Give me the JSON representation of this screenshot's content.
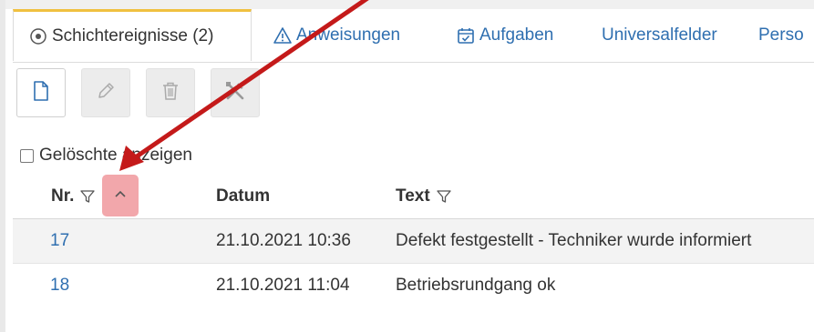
{
  "tabs": [
    {
      "label": "Schichtereignisse (2)",
      "icon": "target-icon",
      "active": true
    },
    {
      "label": "Anweisungen",
      "icon": "warning-icon",
      "active": false
    },
    {
      "label": "Aufgaben",
      "icon": "calendar-check-icon",
      "active": false
    },
    {
      "label": "Universalfelder",
      "icon": "",
      "active": false
    },
    {
      "label": "Perso",
      "icon": "",
      "active": false
    }
  ],
  "toolbar": [
    {
      "name": "new-document",
      "icon": "document-icon",
      "enabled": true
    },
    {
      "name": "edit",
      "icon": "pencil-icon",
      "enabled": false
    },
    {
      "name": "delete",
      "icon": "trash-icon",
      "enabled": false
    },
    {
      "name": "tools",
      "icon": "tools-icon",
      "enabled": false
    }
  ],
  "show_deleted_label": "Gelöschte anzeigen",
  "table": {
    "columns": [
      "Nr.",
      "Datum",
      "Text"
    ],
    "rows": [
      {
        "nr": "17",
        "datum": "21.10.2021 10:36",
        "text": "Defekt festgestellt - Techniker wurde informiert"
      },
      {
        "nr": "18",
        "datum": "21.10.2021 11:04",
        "text": "Betriebsrundgang ok"
      }
    ]
  },
  "colors": {
    "link": "#2f6fb0",
    "active_tab_border": "#f0c040",
    "sort_highlight": "#f2a7ab",
    "annotation_arrow": "#c41a1a"
  }
}
